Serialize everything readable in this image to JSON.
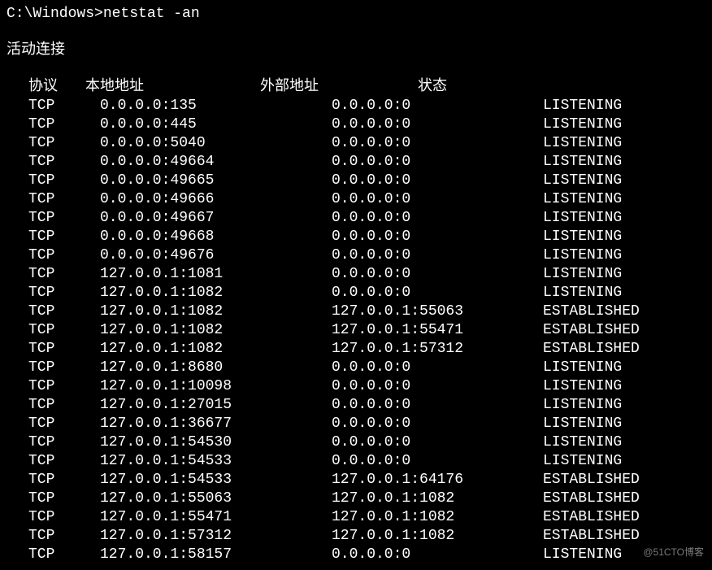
{
  "prompt": "C:\\Windows>netstat -an",
  "section_title": "活动连接",
  "headers": {
    "proto": "协议",
    "local": "本地地址",
    "foreign": "外部地址",
    "state": "状态"
  },
  "rows": [
    {
      "proto": "TCP",
      "local": "0.0.0.0:135",
      "foreign": "0.0.0.0:0",
      "state": "LISTENING"
    },
    {
      "proto": "TCP",
      "local": "0.0.0.0:445",
      "foreign": "0.0.0.0:0",
      "state": "LISTENING"
    },
    {
      "proto": "TCP",
      "local": "0.0.0.0:5040",
      "foreign": "0.0.0.0:0",
      "state": "LISTENING"
    },
    {
      "proto": "TCP",
      "local": "0.0.0.0:49664",
      "foreign": "0.0.0.0:0",
      "state": "LISTENING"
    },
    {
      "proto": "TCP",
      "local": "0.0.0.0:49665",
      "foreign": "0.0.0.0:0",
      "state": "LISTENING"
    },
    {
      "proto": "TCP",
      "local": "0.0.0.0:49666",
      "foreign": "0.0.0.0:0",
      "state": "LISTENING"
    },
    {
      "proto": "TCP",
      "local": "0.0.0.0:49667",
      "foreign": "0.0.0.0:0",
      "state": "LISTENING"
    },
    {
      "proto": "TCP",
      "local": "0.0.0.0:49668",
      "foreign": "0.0.0.0:0",
      "state": "LISTENING"
    },
    {
      "proto": "TCP",
      "local": "0.0.0.0:49676",
      "foreign": "0.0.0.0:0",
      "state": "LISTENING"
    },
    {
      "proto": "TCP",
      "local": "127.0.0.1:1081",
      "foreign": "0.0.0.0:0",
      "state": "LISTENING"
    },
    {
      "proto": "TCP",
      "local": "127.0.0.1:1082",
      "foreign": "0.0.0.0:0",
      "state": "LISTENING"
    },
    {
      "proto": "TCP",
      "local": "127.0.0.1:1082",
      "foreign": "127.0.0.1:55063",
      "state": "ESTABLISHED"
    },
    {
      "proto": "TCP",
      "local": "127.0.0.1:1082",
      "foreign": "127.0.0.1:55471",
      "state": "ESTABLISHED"
    },
    {
      "proto": "TCP",
      "local": "127.0.0.1:1082",
      "foreign": "127.0.0.1:57312",
      "state": "ESTABLISHED"
    },
    {
      "proto": "TCP",
      "local": "127.0.0.1:8680",
      "foreign": "0.0.0.0:0",
      "state": "LISTENING"
    },
    {
      "proto": "TCP",
      "local": "127.0.0.1:10098",
      "foreign": "0.0.0.0:0",
      "state": "LISTENING"
    },
    {
      "proto": "TCP",
      "local": "127.0.0.1:27015",
      "foreign": "0.0.0.0:0",
      "state": "LISTENING"
    },
    {
      "proto": "TCP",
      "local": "127.0.0.1:36677",
      "foreign": "0.0.0.0:0",
      "state": "LISTENING"
    },
    {
      "proto": "TCP",
      "local": "127.0.0.1:54530",
      "foreign": "0.0.0.0:0",
      "state": "LISTENING"
    },
    {
      "proto": "TCP",
      "local": "127.0.0.1:54533",
      "foreign": "0.0.0.0:0",
      "state": "LISTENING"
    },
    {
      "proto": "TCP",
      "local": "127.0.0.1:54533",
      "foreign": "127.0.0.1:64176",
      "state": "ESTABLISHED"
    },
    {
      "proto": "TCP",
      "local": "127.0.0.1:55063",
      "foreign": "127.0.0.1:1082",
      "state": "ESTABLISHED"
    },
    {
      "proto": "TCP",
      "local": "127.0.0.1:55471",
      "foreign": "127.0.0.1:1082",
      "state": "ESTABLISHED"
    },
    {
      "proto": "TCP",
      "local": "127.0.0.1:57312",
      "foreign": "127.0.0.1:1082",
      "state": "ESTABLISHED"
    },
    {
      "proto": "TCP",
      "local": "127.0.0.1:58157",
      "foreign": "0.0.0.0:0",
      "state": "LISTENING"
    }
  ],
  "watermark": "@51CTO博客"
}
